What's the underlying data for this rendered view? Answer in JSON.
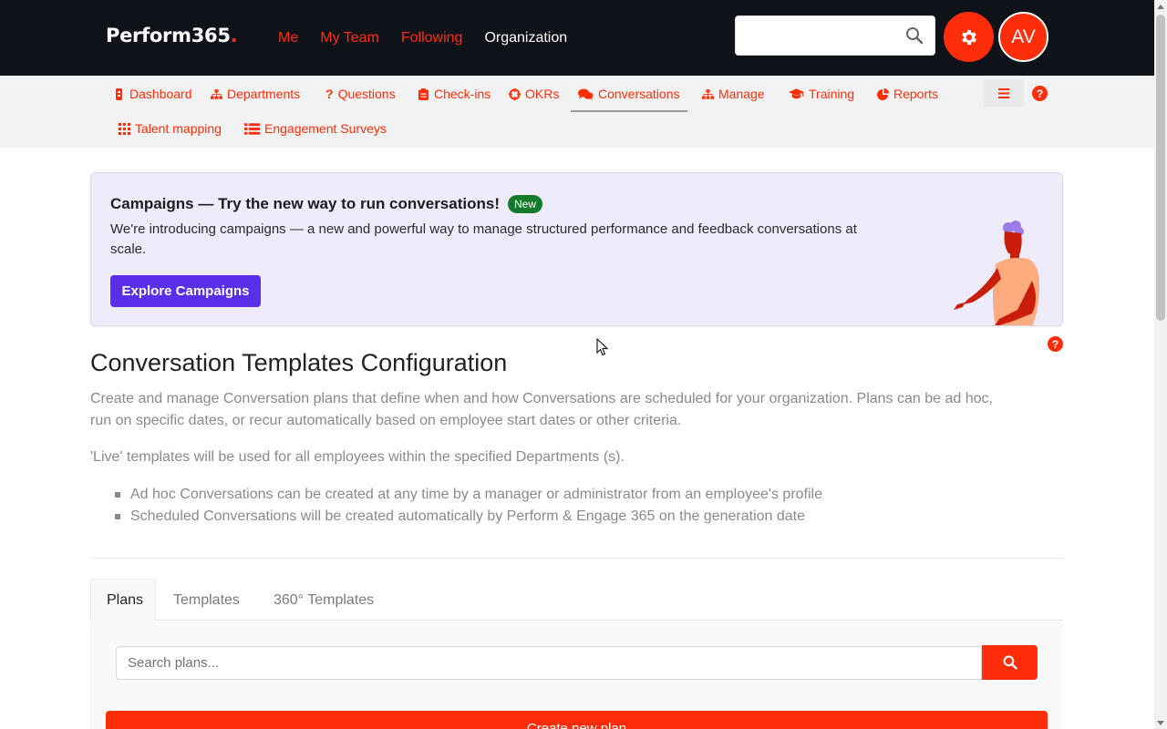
{
  "header": {
    "brand": "Perform365",
    "brand_dot": ".",
    "nav": [
      {
        "label": "Me"
      },
      {
        "label": "My Team"
      },
      {
        "label": "Following"
      },
      {
        "label": "Organization"
      }
    ],
    "search_value": "",
    "search_icon": "search-icon",
    "settings_icon": "gear-icon",
    "avatar_initials": "AV"
  },
  "subnav": {
    "items": [
      {
        "label": "Dashboard",
        "icon": "dashboard-icon"
      },
      {
        "label": "Departments",
        "icon": "sitemap-icon"
      },
      {
        "label": "Questions",
        "icon": "question-icon"
      },
      {
        "label": "Check-ins",
        "icon": "clipboard-icon"
      },
      {
        "label": "OKRs",
        "icon": "crosshairs-icon"
      },
      {
        "label": "Conversations",
        "icon": "comments-icon"
      },
      {
        "label": "Manage",
        "icon": "sitemap-icon"
      },
      {
        "label": "Training",
        "icon": "graduation-cap-icon"
      },
      {
        "label": "Reports",
        "icon": "pie-chart-icon"
      },
      {
        "label": "Talent mapping",
        "icon": "grid-icon"
      },
      {
        "label": "Engagement Surveys",
        "icon": "list-icon"
      }
    ],
    "active": "Conversations",
    "help_glyph": "?"
  },
  "banner": {
    "title": "Campaigns — Try the new way to run conversations!",
    "badge": "New",
    "text": "We're introducing campaigns — a new and powerful way to manage structured performance and feedback conversations at scale.",
    "button": "Explore Campaigns"
  },
  "main": {
    "title": "Conversation Templates Configuration",
    "desc1": "Create and manage Conversation plans that define when and how Conversations are scheduled for your organization. Plans can be ad hoc, run on specific dates, or recur automatically based on employee start dates or other criteria.",
    "desc2": "'Live' templates will be used for all employees within the specified Departments (s).",
    "bullets": [
      "Ad hoc Conversations can be created at any time by a manager or administrator from an employee's profile",
      "Scheduled Conversations will be created automatically by Perform & Engage 365 on the generation date"
    ],
    "help_glyph": "?"
  },
  "tabs": [
    {
      "label": "Plans"
    },
    {
      "label": "Templates"
    },
    {
      "label": "360° Templates"
    }
  ],
  "plans": {
    "search_placeholder": "Search plans...",
    "create_button": "Create new plan"
  },
  "colors": {
    "accent": "#ff2d0a",
    "header_bg": "#0f1219",
    "campaign_button": "#5b2ee8",
    "new_badge": "#157a2b"
  }
}
